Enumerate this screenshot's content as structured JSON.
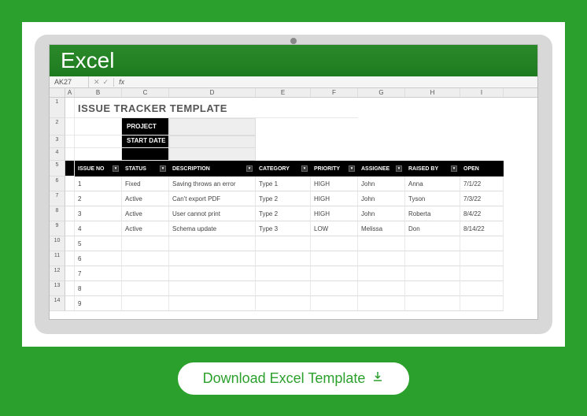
{
  "app": {
    "name": "Excel",
    "cell_ref": "AK27"
  },
  "columns": [
    "A",
    "B",
    "C",
    "D",
    "E",
    "F",
    "G",
    "H",
    "I"
  ],
  "title": "ISSUE TRACKER TEMPLATE",
  "meta": {
    "project_label": "PROJECT",
    "startdate_label": "START DATE",
    "project_value": "",
    "startdate_value": ""
  },
  "headers": [
    "ISSUE NO",
    "STATUS",
    "DESCRIPTION",
    "CATEGORY",
    "PRIORITY",
    "ASSIGNEE",
    "RAISED BY",
    "OPEN"
  ],
  "chart_data": {
    "type": "table",
    "columns": [
      "ISSUE NO",
      "STATUS",
      "DESCRIPTION",
      "CATEGORY",
      "PRIORITY",
      "ASSIGNEE",
      "RAISED BY",
      "OPEN"
    ],
    "rows": [
      {
        "issue_no": "1",
        "status": "Fixed",
        "description": "Saving throws an error",
        "category": "Type 1",
        "priority": "HIGH",
        "assignee": "John",
        "raised_by": "Anna",
        "open": "7/1/22"
      },
      {
        "issue_no": "2",
        "status": "Active",
        "description": "Can't export PDF",
        "category": "Type 2",
        "priority": "HIGH",
        "assignee": "John",
        "raised_by": "Tyson",
        "open": "7/3/22"
      },
      {
        "issue_no": "3",
        "status": "Active",
        "description": "User cannot print",
        "category": "Type 2",
        "priority": "HIGH",
        "assignee": "John",
        "raised_by": "Roberta",
        "open": "8/4/22"
      },
      {
        "issue_no": "4",
        "status": "Active",
        "description": "Schema update",
        "category": "Type 3",
        "priority": "LOW",
        "assignee": "Melissa",
        "raised_by": "Don",
        "open": "8/14/22"
      },
      {
        "issue_no": "5",
        "status": "",
        "description": "",
        "category": "",
        "priority": "",
        "assignee": "",
        "raised_by": "",
        "open": ""
      },
      {
        "issue_no": "6",
        "status": "",
        "description": "",
        "category": "",
        "priority": "",
        "assignee": "",
        "raised_by": "",
        "open": ""
      },
      {
        "issue_no": "7",
        "status": "",
        "description": "",
        "category": "",
        "priority": "",
        "assignee": "",
        "raised_by": "",
        "open": ""
      },
      {
        "issue_no": "8",
        "status": "",
        "description": "",
        "category": "",
        "priority": "",
        "assignee": "",
        "raised_by": "",
        "open": ""
      },
      {
        "issue_no": "9",
        "status": "",
        "description": "",
        "category": "",
        "priority": "",
        "assignee": "",
        "raised_by": "",
        "open": ""
      }
    ]
  },
  "row_numbers": [
    "1",
    "2",
    "3",
    "4",
    "5",
    "6",
    "7",
    "8",
    "9",
    "10",
    "11",
    "12",
    "13",
    "14"
  ],
  "download": {
    "label": "Download Excel Template"
  }
}
